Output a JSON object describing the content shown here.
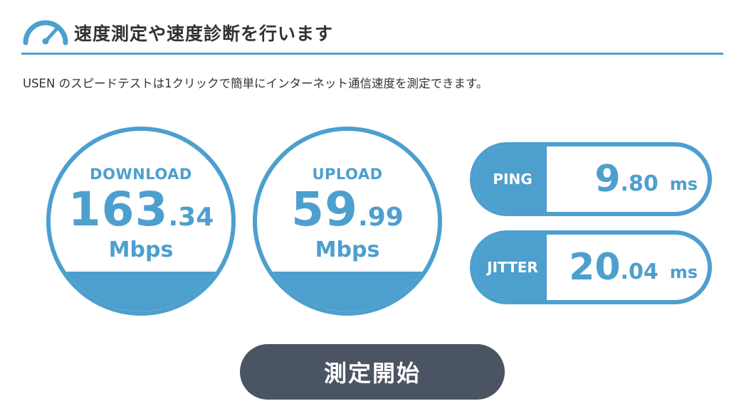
{
  "header": {
    "title": "速度測定や速度診断を行います",
    "icon": "speedometer-icon"
  },
  "description": "USEN のスピードテストは1クリックで簡単にインターネット通信速度を測定できます。",
  "download": {
    "label": "DOWNLOAD",
    "value_int": "163",
    "value_dec": ".34",
    "unit": "Mbps"
  },
  "upload": {
    "label": "UPLOAD",
    "value_int": "59",
    "value_dec": ".99",
    "unit": "Mbps"
  },
  "ping": {
    "label": "PING",
    "value_int": "9",
    "value_dec": ".80",
    "unit": "ms"
  },
  "jitter": {
    "label": "JITTER",
    "value_int": "20",
    "value_dec": ".04",
    "unit": "ms"
  },
  "start_button": {
    "label": "測定開始"
  },
  "colors": {
    "accent": "#4d9fce",
    "button": "#4a5463",
    "text": "#333333"
  }
}
